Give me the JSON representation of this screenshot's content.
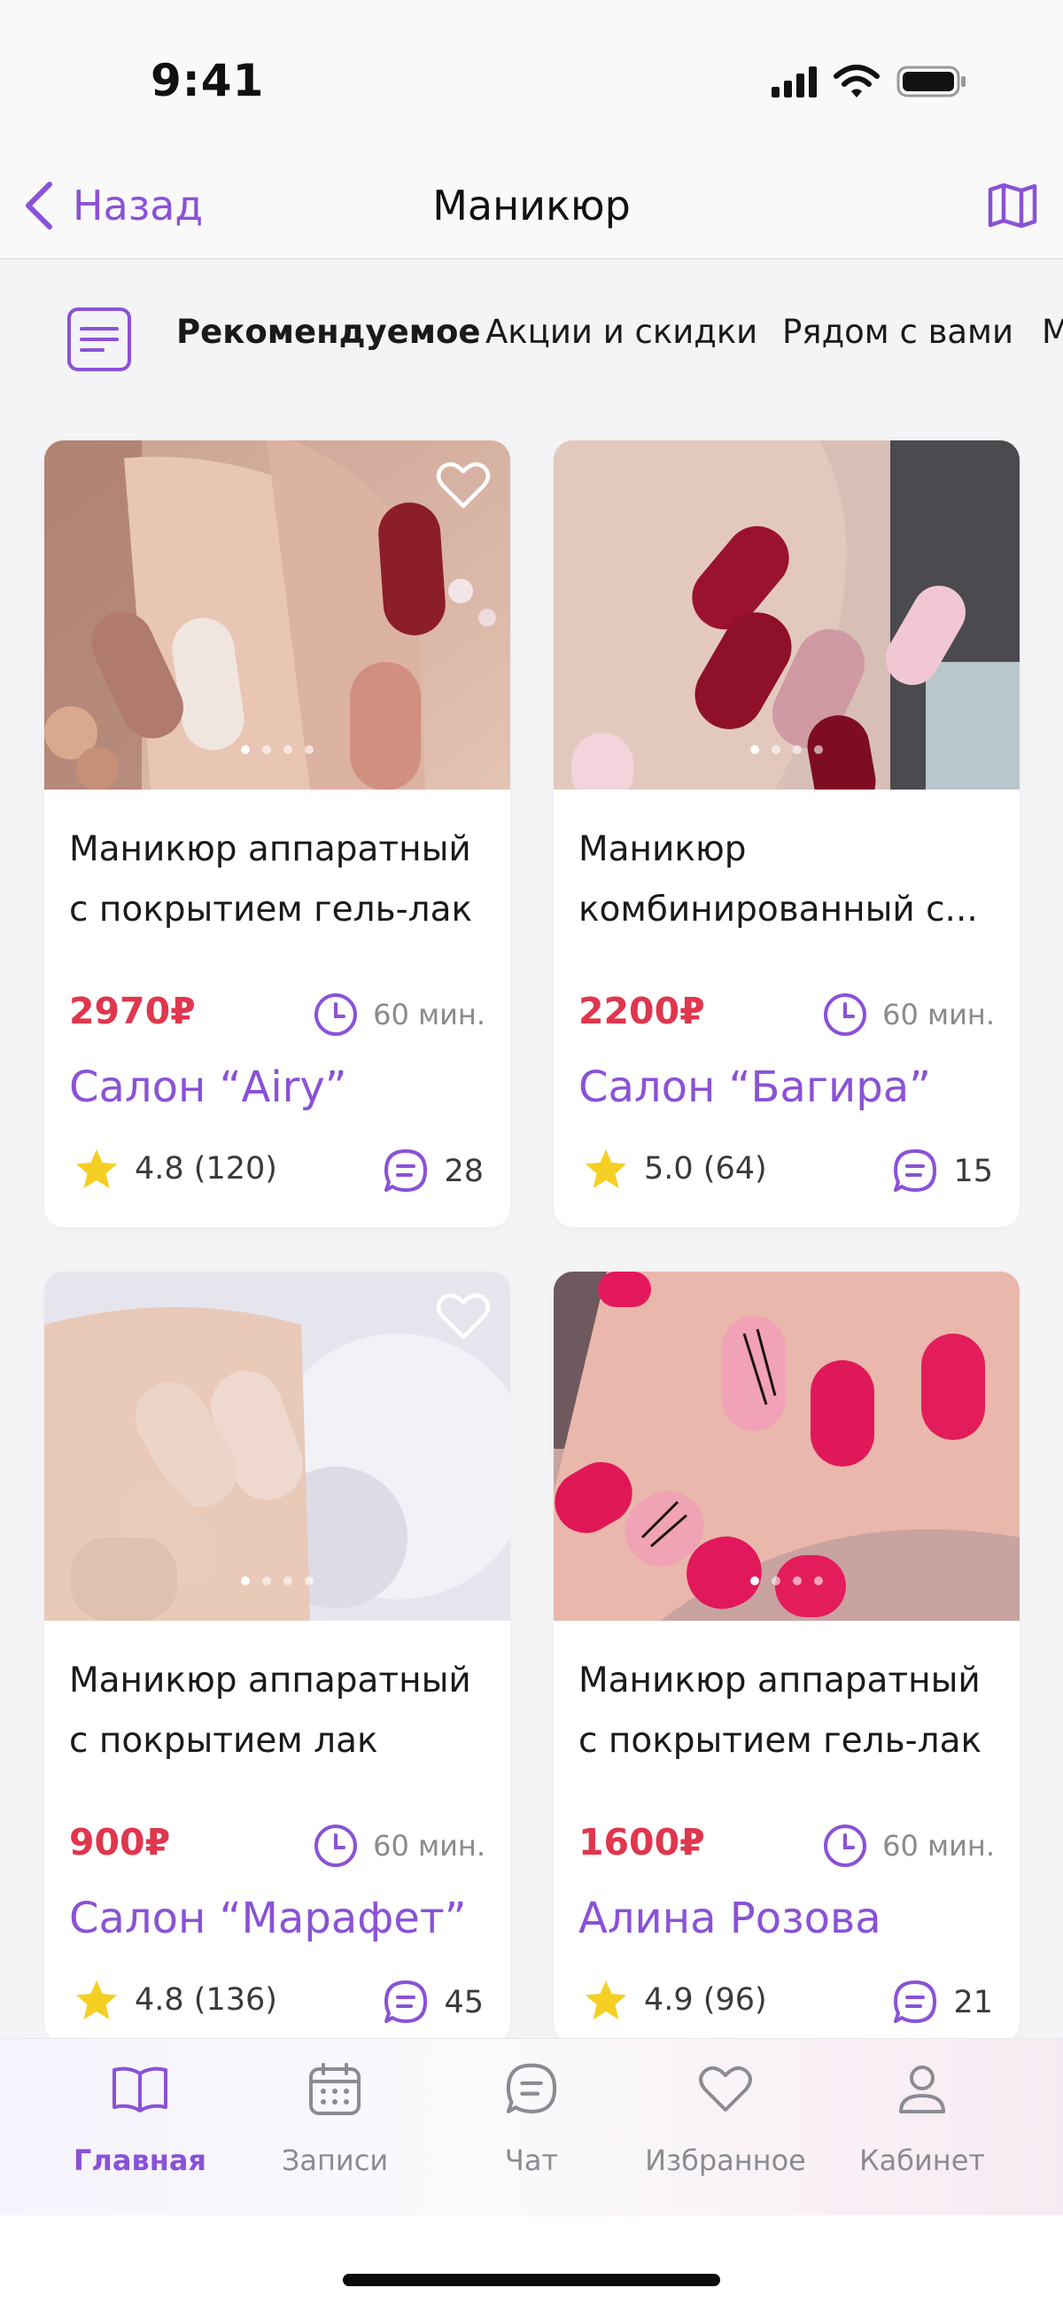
{
  "status_bar": {
    "time": "9:41"
  },
  "nav": {
    "back_label": "Назад",
    "title": "Маникюр"
  },
  "filters": {
    "tabs": [
      {
        "label": "Рекомендуемое",
        "active": true
      },
      {
        "label": "Акции и скидки",
        "active": false
      },
      {
        "label": "Рядом с вами",
        "active": false
      },
      {
        "label": "М",
        "active": false
      }
    ]
  },
  "cards": [
    {
      "title": "Маникюр аппаратный с покрытием гель-лак",
      "price": "2970₽",
      "duration": "60 мин.",
      "salon": "Салон “Airy”",
      "rating": "4.8 (120)",
      "comments": "28",
      "favorite": false
    },
    {
      "title": "Маникюр комбинированный с...",
      "price": "2200₽",
      "duration": "60 мин.",
      "salon": "Салон “Багира”",
      "rating": "5.0 (64)",
      "comments": "15",
      "favorite": false
    },
    {
      "title": "Маникюр аппаратный с покрытием лак",
      "price": "900₽",
      "duration": "60 мин.",
      "salon": "Салон “Марафет”",
      "rating": "4.8 (136)",
      "comments": "45",
      "favorite": false
    },
    {
      "title": "Маникюр аппаратный с покрытием гель-лак",
      "price": "1600₽",
      "duration": "60 мин.",
      "salon": "Алина Розова",
      "rating": "4.9 (96)",
      "comments": "21",
      "favorite": false
    }
  ],
  "tab_bar": {
    "items": [
      {
        "label": "Главная",
        "icon": "book-icon",
        "active": true
      },
      {
        "label": "Записи",
        "icon": "calendar-icon",
        "active": false
      },
      {
        "label": "Чат",
        "icon": "chat-icon",
        "active": false
      },
      {
        "label": "Избранное",
        "icon": "heart-icon",
        "active": false
      },
      {
        "label": "Кабинет",
        "icon": "user-icon",
        "active": false
      }
    ]
  },
  "colors": {
    "accent": "#8a52d6",
    "price": "#e0364e",
    "star": "#f5cf23"
  }
}
